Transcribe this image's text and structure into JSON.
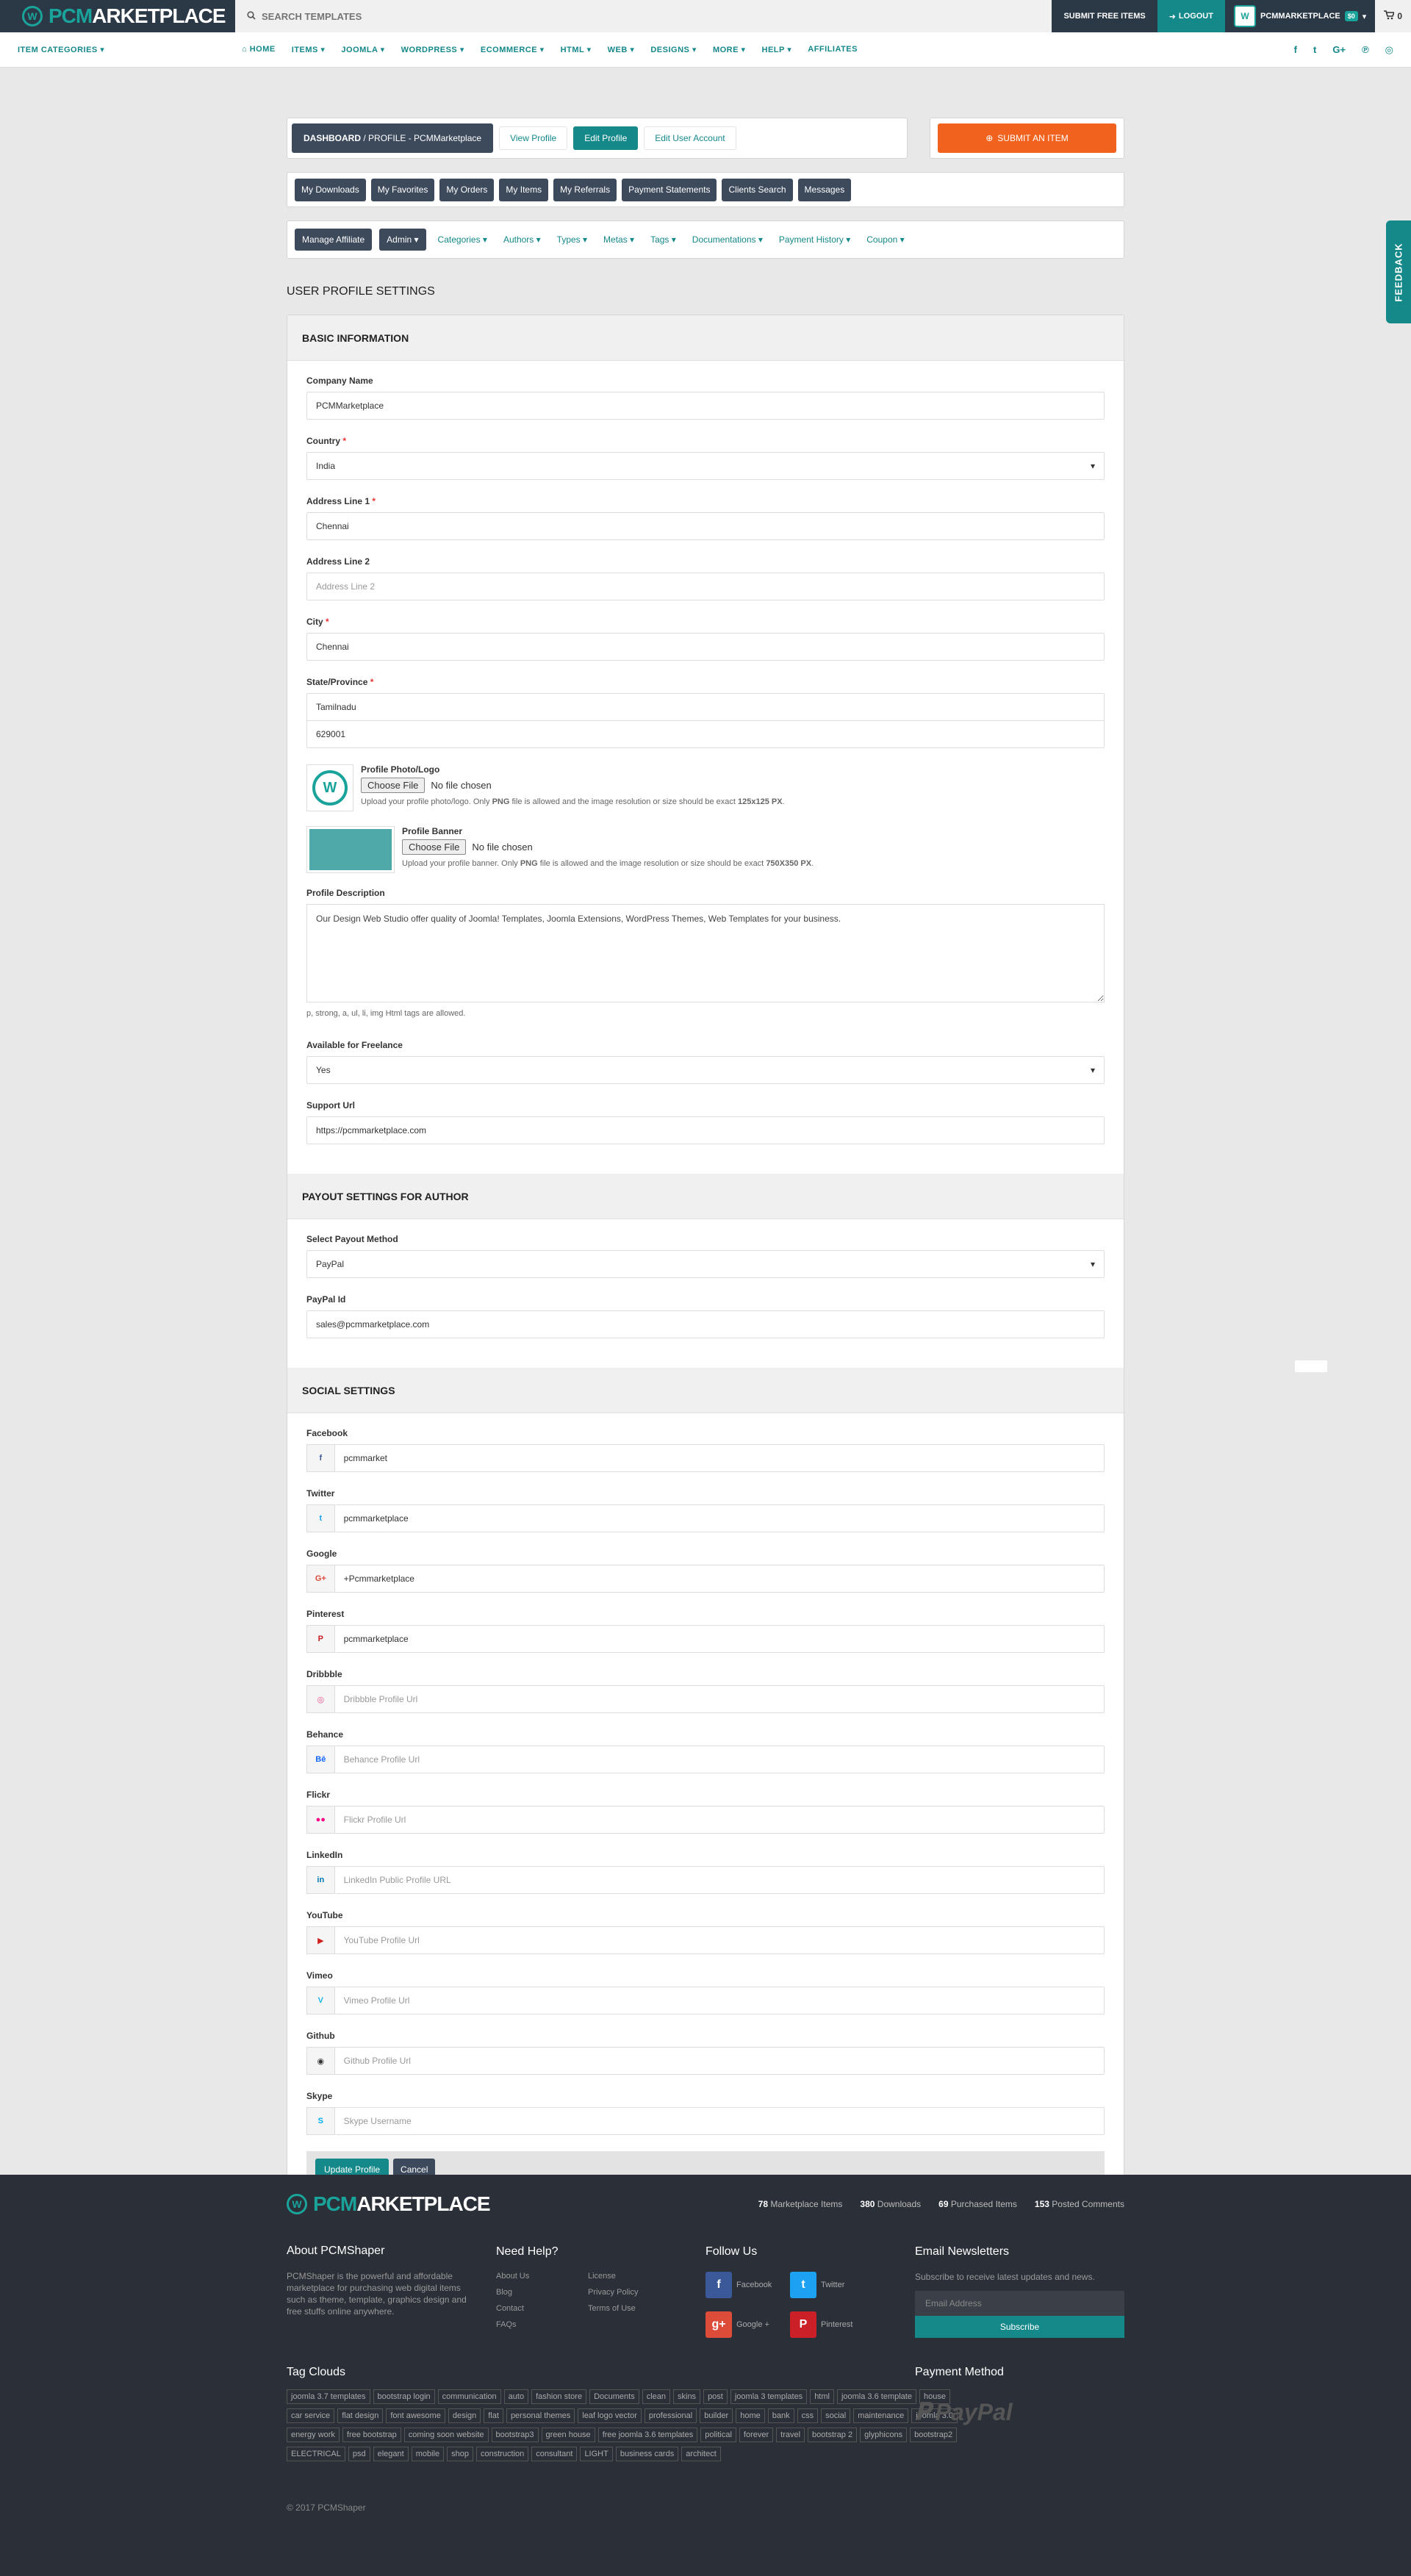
{
  "topbar": {
    "logo_pc": "PCM",
    "logo_rest": "ARKETPLACE",
    "search_placeholder": "SEARCH TEMPLATES",
    "submit_free": "SUBMIT FREE ITEMS",
    "logout": "LOGOUT",
    "username": "PCMMARKETPLACE",
    "user_badge": "$0",
    "cart_count": "0"
  },
  "nav": {
    "categories": "ITEM CATEGORIES",
    "items": [
      "HOME",
      "ITEMS",
      "JOOMLA",
      "WORDPRESS",
      "ECOMMERCE",
      "HTML",
      "WEB",
      "DESIGNS",
      "MORE",
      "HELP",
      "AFFILIATES"
    ]
  },
  "breadcrumb": {
    "dashboard": "DASHBOARD",
    "separator": "/",
    "rest": "PROFILE - PCMMarketplace",
    "view_profile": "View Profile",
    "edit_profile": "Edit Profile",
    "edit_account": "Edit User Account",
    "submit_item": "SUBMIT AN ITEM"
  },
  "tabs": [
    "My Downloads",
    "My Favorites",
    "My Orders",
    "My Items",
    "My Referrals",
    "Payment Statements",
    "Clients Search",
    "Messages"
  ],
  "admin_bar": {
    "manage_affiliate": "Manage Affiliate",
    "admin": "Admin",
    "links": [
      "Categories",
      "Authors",
      "Types",
      "Metas",
      "Tags",
      "Documentations",
      "Payment History",
      "Coupon"
    ]
  },
  "page_title": "USER PROFILE SETTINGS",
  "basic": {
    "heading": "BASIC INFORMATION",
    "company_label": "Company Name",
    "company_value": "PCMMarketplace",
    "country_label": "Country",
    "country_value": "India",
    "addr1_label": "Address Line 1",
    "addr1_value": "Chennai",
    "addr2_label": "Address Line 2",
    "addr2_placeholder": "Address Line 2",
    "city_label": "City",
    "city_value": "Chennai",
    "state_label": "State/Province",
    "state_value": "Tamilnadu",
    "zip_value": "629001",
    "photo_label": "Profile Photo/Logo",
    "choose_file": "Choose File",
    "no_file": "No file chosen",
    "photo_hint_pre": "Upload your profile photo/logo. Only",
    "photo_hint_png": "PNG",
    "photo_hint_mid": "file is allowed and the image resolution or size should be exact",
    "photo_hint_size": "125x125 PX",
    "banner_label": "Profile Banner",
    "banner_hint_pre": "Upload your profile banner. Only",
    "banner_hint_size": "750X350 PX",
    "desc_label": "Profile Description",
    "desc_value": "Our Design Web Studio offer quality of Joomla! Templates, Joomla Extensions, WordPress Themes, Web Templates for your business.",
    "desc_hint": "p, strong, a, ul, li, img Html tags are allowed.",
    "freelance_label": "Available for Freelance",
    "freelance_value": "Yes",
    "support_label": "Support Url",
    "support_value": "https://pcmmarketplace.com"
  },
  "payout": {
    "heading": "PAYOUT SETTINGS FOR AUTHOR",
    "method_label": "Select Payout Method",
    "method_value": "PayPal",
    "paypal_label": "PayPal Id",
    "paypal_value": "sales@pcmmarketplace.com"
  },
  "social": {
    "heading": "SOCIAL SETTINGS",
    "fields": [
      {
        "label": "Facebook",
        "value": "pcmmarket",
        "icon": "f",
        "color": "#3b5998",
        "ph": false
      },
      {
        "label": "Twitter",
        "value": "pcmmarketplace",
        "icon": "t",
        "color": "#1da1f2",
        "ph": false
      },
      {
        "label": "Google",
        "value": "+Pcmmarketplace",
        "icon": "G+",
        "color": "#dd4b39",
        "ph": false
      },
      {
        "label": "Pinterest",
        "value": "pcmmarketplace",
        "icon": "P",
        "color": "#cb2027",
        "ph": false
      },
      {
        "label": "Dribbble",
        "value": "Dribbble Profile Url",
        "icon": "◎",
        "color": "#ea4c89",
        "ph": true
      },
      {
        "label": "Behance",
        "value": "Behance Profile Url",
        "icon": "Bē",
        "color": "#1769ff",
        "ph": true
      },
      {
        "label": "Flickr",
        "value": "Flickr Profile Url",
        "icon": "●●",
        "color": "#ff0084",
        "ph": true
      },
      {
        "label": "LinkedIn",
        "value": "LinkedIn Public Profile URL",
        "icon": "in",
        "color": "#0077b5",
        "ph": true
      },
      {
        "label": "YouTube",
        "value": "YouTube Profile Url",
        "icon": "▶",
        "color": "#cd201f",
        "ph": true
      },
      {
        "label": "Vimeo",
        "value": "Vimeo Profile Url",
        "icon": "V",
        "color": "#1ab7ea",
        "ph": true
      },
      {
        "label": "Github",
        "value": "Github Profile Url",
        "icon": "◉",
        "color": "#333333",
        "ph": true
      },
      {
        "label": "Skype",
        "value": "Skype Username",
        "icon": "S",
        "color": "#00aff0",
        "ph": true
      }
    ],
    "update_btn": "Update Profile",
    "cancel_btn": "Cancel"
  },
  "feedback": "FEEDBACK",
  "footer": {
    "logo_pc": "PCM",
    "logo_rest": "ARKETPLACE",
    "stat_items_n": "78",
    "stat_items": "Marketplace Items",
    "stat_dl_n": "380",
    "stat_dl": "Downloads",
    "stat_purchased_n": "69",
    "stat_purchased": "Purchased Items",
    "stat_comments_n": "153",
    "stat_comments": "Posted Comments",
    "about_title": "About PCMShaper",
    "about_text": "PCMShaper is the powerful and affordable marketplace for purchasing web digital items such as theme, template, graphics design and free stuffs online anywhere.",
    "help_title": "Need Help?",
    "help_links": [
      "About Us",
      "License",
      "Blog",
      "Privacy Policy",
      "Contact",
      "Terms of Use",
      "FAQs"
    ],
    "follow_title": "Follow Us",
    "follow": [
      {
        "name": "Facebook",
        "icon": "f",
        "color": "#3b5998"
      },
      {
        "name": "Twitter",
        "icon": "t",
        "color": "#1da1f2"
      },
      {
        "name": "Google +",
        "icon": "g+",
        "color": "#dd4b39"
      },
      {
        "name": "Pinterest",
        "icon": "P",
        "color": "#cb2027"
      }
    ],
    "news_title": "Email Newsletters",
    "news_text": "Subscribe to receive latest updates and news.",
    "email_placeholder": "Email Address",
    "subscribe": "Subscribe",
    "tags_title": "Tag Clouds",
    "tags": [
      "joomla 3.7 templates",
      "bootstrap login",
      "communication",
      "auto",
      "fashion store",
      "Documents",
      "clean",
      "skins",
      "post",
      "joomla 3 templates",
      "html",
      "joomla 3.6 template",
      "house",
      "car service",
      "flat design",
      "font awesome",
      "design",
      "flat",
      "personal themes",
      "leaf logo vector",
      "professional",
      "builder",
      "home",
      "bank",
      "css",
      "social",
      "maintenance",
      "joomla 3.0",
      "energy work",
      "free bootstrap",
      "coming soon website",
      "bootstrap3",
      "green house",
      "free joomla 3.6 templates",
      "political",
      "forever",
      "travel",
      "bootstrap 2",
      "glyphicons",
      "bootstrap2",
      "ELECTRICAL",
      "psd",
      "elegant",
      "mobile",
      "shop",
      "construction",
      "consultant",
      "LIGHT",
      "business cards",
      "architect"
    ],
    "payment_title": "Payment Method",
    "paypal": "PayPal",
    "copyright": "© 2017 PCMShaper"
  }
}
